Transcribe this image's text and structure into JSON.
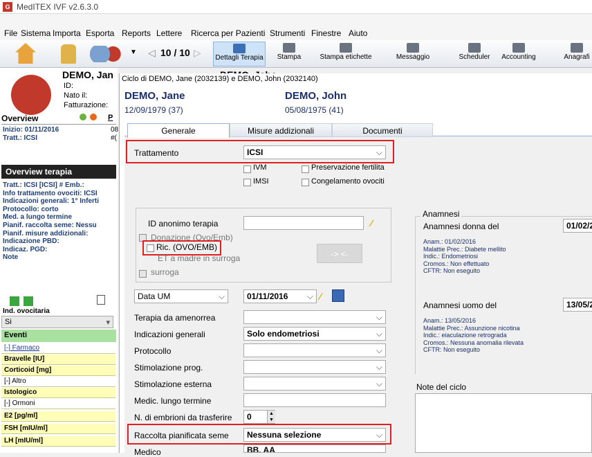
{
  "app": {
    "title": "MedITEX IVF v2.6.3.0",
    "logo": "G"
  },
  "menu": [
    "File",
    "Sistema",
    "Importa",
    "Esporta",
    "Reports",
    "Lettere",
    "Ricerca per Pazienti",
    "Strumenti",
    "Finestre",
    "Aiuto"
  ],
  "toolbar": {
    "counter": "10 / 10",
    "buttons": [
      "Dettagli Terapia",
      "Stampa",
      "Stampa etichette",
      "Messaggio",
      "Scheduler",
      "Accounting",
      "Anagrafi"
    ]
  },
  "patient": {
    "name": "DEMO, Jan",
    "id_label": "ID:",
    "born_label": "Nato il:",
    "billing_label": "Fatturazione:"
  },
  "overview": {
    "title": "Overview",
    "col": "P",
    "start": "Inizio: 01/11/2016",
    "treat": "Tratt.: ICSI",
    "start_r": "08",
    "treat_r": "#("
  },
  "therapy_overview": {
    "title": "Overview terapia",
    "lines": [
      "Tratt.: ICSI   [ICSI]    # Emb.:",
      "Info trattamento ovociti: ICSI",
      "Indicazioni generali: 1° Inferti",
      "Protocollo: corto",
      "Med. a lungo termine",
      "Pianif. raccolta seme: Nessu",
      "Pianif. misure addizionali:",
      "Indicazione PBD:",
      "Indicaz. PGD:",
      "Note"
    ]
  },
  "left_lower": {
    "ovo_label": "Ind. ovocitaria",
    "ovo_value": "Si",
    "eventi": "Eventi",
    "farmaco": "[-]  Farmaco",
    "bravelle": "Bravelle [IU]",
    "corticoid": "Corticoid [mg]",
    "altro": "[-]  Altro",
    "istologico": "Istologico",
    "ormoni": "[-]  Ormoni",
    "e2": "E2  [pg/ml]",
    "fsh": "FSH  [mIU/ml]",
    "lh": "LH  [mIU/ml]"
  },
  "dialog": {
    "title": "Ciclo di DEMO, Jane (2032139) e DEMO, John (2032140)",
    "bg_title": "DEMO, Jaho",
    "female": {
      "name": "DEMO, Jane",
      "dob": "12/09/1979   (37)"
    },
    "male": {
      "name": "DEMO, John",
      "dob": "05/08/1975   (41)"
    },
    "tabs": [
      "Generale",
      "Misure addizionali",
      "Documenti"
    ],
    "trattamento_label": "Trattamento",
    "trattamento_value": "ICSI",
    "checks": {
      "ivm": "IVM",
      "imsi": "IMSI",
      "pres": "Preservazione fertilita",
      "cong": "Congelamento ovociti"
    },
    "id_anon_label": "ID anonimo terapia",
    "donazione": "Donazione (Ovo/Emb)",
    "ric": "Ric. (OVO/EMB)",
    "et_madre": "ET a madre in surroga",
    "surroga": "surroga",
    "arrow_btn": "-> <-",
    "data_um_label": "Data UM",
    "data_um_value": "01/11/2016",
    "rows": [
      "Terapia da amenorrea",
      "Indicazioni generali",
      "Protocollo",
      "Stimolazione prog.",
      "Stimolazione esterna",
      "Medic. lungo termine",
      "N. di embrioni da trasferire",
      "Raccolta pianificata seme",
      "Medico"
    ],
    "indicazioni_value": "Solo endometriosi",
    "embrioni_value": "0",
    "raccolta_value": "Nessuna selezione",
    "medico_value": "BB, AA",
    "anamnesi": {
      "title": "Anamnesi",
      "donna_label": "Anamnesi donna del",
      "donna_date": "01/02/2",
      "donna_lines": [
        "Anam.: 01/02/2016",
        "Malattie Prec.: Diabete mellito",
        "Indic.: Endometriosi",
        "Cromos.: Non effettuato",
        "CFTR: Non eseguito"
      ],
      "uomo_label": "Anamnesi uomo del",
      "uomo_date": "13/05/2",
      "uomo_lines": [
        "Anam.: 13/05/2016",
        "Malattie Prec.: Assunzione nicotina",
        "Indic.: eiaculazione retrograda",
        "Cromos.: Nessuna anomalia rilevata",
        "CFTR: Non eseguito"
      ]
    },
    "note_label": "Note del ciclo"
  }
}
